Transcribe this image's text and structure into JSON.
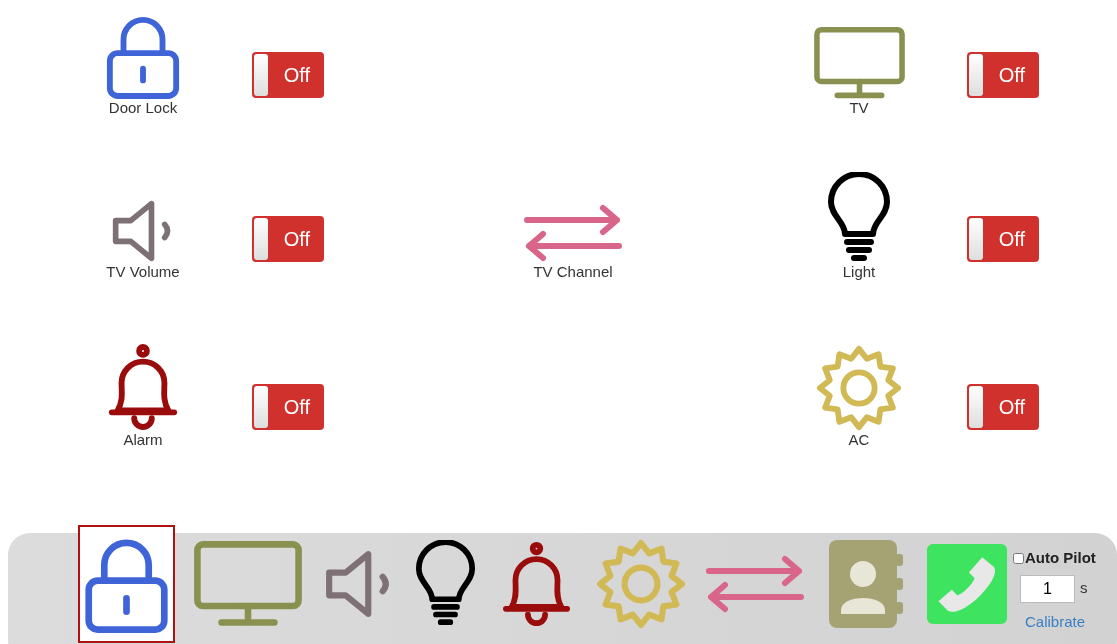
{
  "rows": [
    {
      "left": {
        "kind": "lock",
        "color": "#3f64d8",
        "label": "Door Lock",
        "toggle": {
          "label": "Off",
          "on": false
        }
      },
      "right": {
        "kind": "tv",
        "color": "#8a9150",
        "label": "TV",
        "toggle": {
          "label": "Off",
          "on": false
        }
      }
    },
    {
      "left": {
        "kind": "speaker",
        "color": "#7e7175",
        "label": "TV Volume",
        "toggle": {
          "label": "Off",
          "on": false
        }
      },
      "center": {
        "kind": "arrows",
        "color": "#d9668a",
        "label": "TV Channel"
      },
      "right": {
        "kind": "bulb",
        "color": "#000000",
        "label": "Light",
        "toggle": {
          "label": "Off",
          "on": false
        }
      }
    },
    {
      "left": {
        "kind": "bell",
        "color": "#9a0b0b",
        "label": "Alarm",
        "toggle": {
          "label": "Off",
          "on": false
        }
      },
      "right": {
        "kind": "gear",
        "color": "#d1b955",
        "label": "AC",
        "toggle": {
          "label": "Off",
          "on": false
        }
      }
    }
  ],
  "dock": {
    "items": [
      {
        "kind": "lock",
        "color": "#3f64d8",
        "selected": true
      },
      {
        "kind": "tv",
        "color": "#8a9150",
        "selected": false
      },
      {
        "kind": "speaker",
        "color": "#7e7175",
        "selected": false
      },
      {
        "kind": "bulb",
        "color": "#000000",
        "selected": false
      },
      {
        "kind": "bell",
        "color": "#9a0b0b",
        "selected": false
      },
      {
        "kind": "gear",
        "color": "#d1b955",
        "selected": false
      },
      {
        "kind": "arrows",
        "color": "#d9668a",
        "selected": false
      },
      {
        "kind": "contacts",
        "color": "#a5a374",
        "selected": false
      },
      {
        "kind": "phone",
        "color": "#3ee35f",
        "selected": false
      }
    ],
    "auto_pilot": {
      "label": "Auto Pilot",
      "checked": false
    },
    "interval": {
      "value": "1",
      "unit": "s"
    },
    "calibrate_link": "Calibrate"
  }
}
